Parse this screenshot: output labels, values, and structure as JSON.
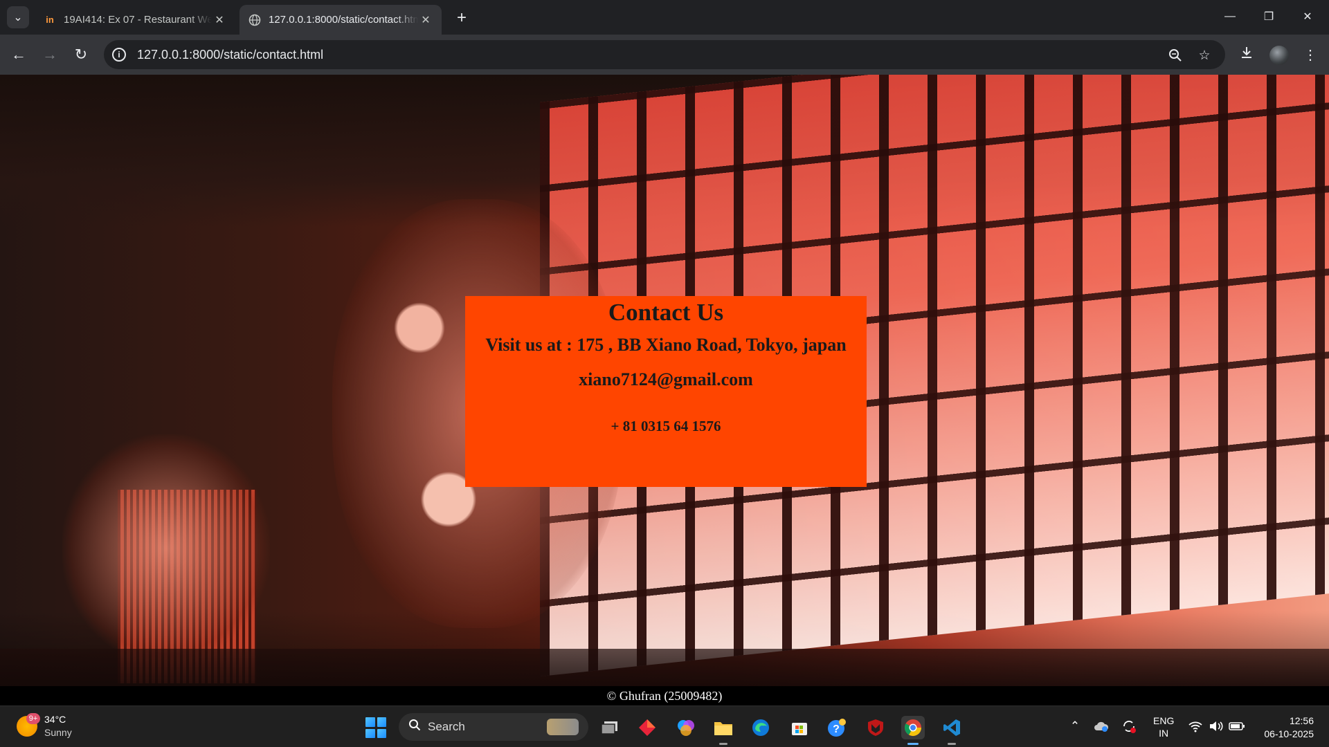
{
  "browser": {
    "tabs": [
      {
        "title": "19AI414: Ex 07 - Restaurant We",
        "favicon": "in",
        "active": false
      },
      {
        "title": "127.0.0.1:8000/static/contact.html",
        "favicon": "globe",
        "active": true
      }
    ],
    "url": "127.0.0.1:8000/static/contact.html",
    "icons": {
      "tab_search": "chevron-down-icon",
      "new_tab": "plus-icon",
      "back": "back-arrow-icon",
      "forward": "forward-arrow-icon",
      "reload": "reload-icon",
      "site_info": "info-icon",
      "zoom": "zoom-icon",
      "bookmark": "star-icon",
      "downloads": "download-icon",
      "menu": "kebab-menu-icon"
    }
  },
  "page": {
    "heading": "Contact Us",
    "address": "Visit us at : 175 , BB Xiano Road, Tokyo, japan",
    "email": "xiano7124@gmail.com",
    "phone": "+ 81 0315 64 1576",
    "footer": "© Ghufran (25009482)",
    "colors": {
      "box_background": "#ff4500",
      "footer_background": "#000000"
    }
  },
  "taskbar": {
    "weather": {
      "temp": "34°C",
      "condition": "Sunny",
      "badge": "9+"
    },
    "search_placeholder": "Search",
    "language": {
      "line1": "ENG",
      "line2": "IN"
    },
    "clock": {
      "time": "12:56",
      "date": "06-10-2025"
    }
  }
}
